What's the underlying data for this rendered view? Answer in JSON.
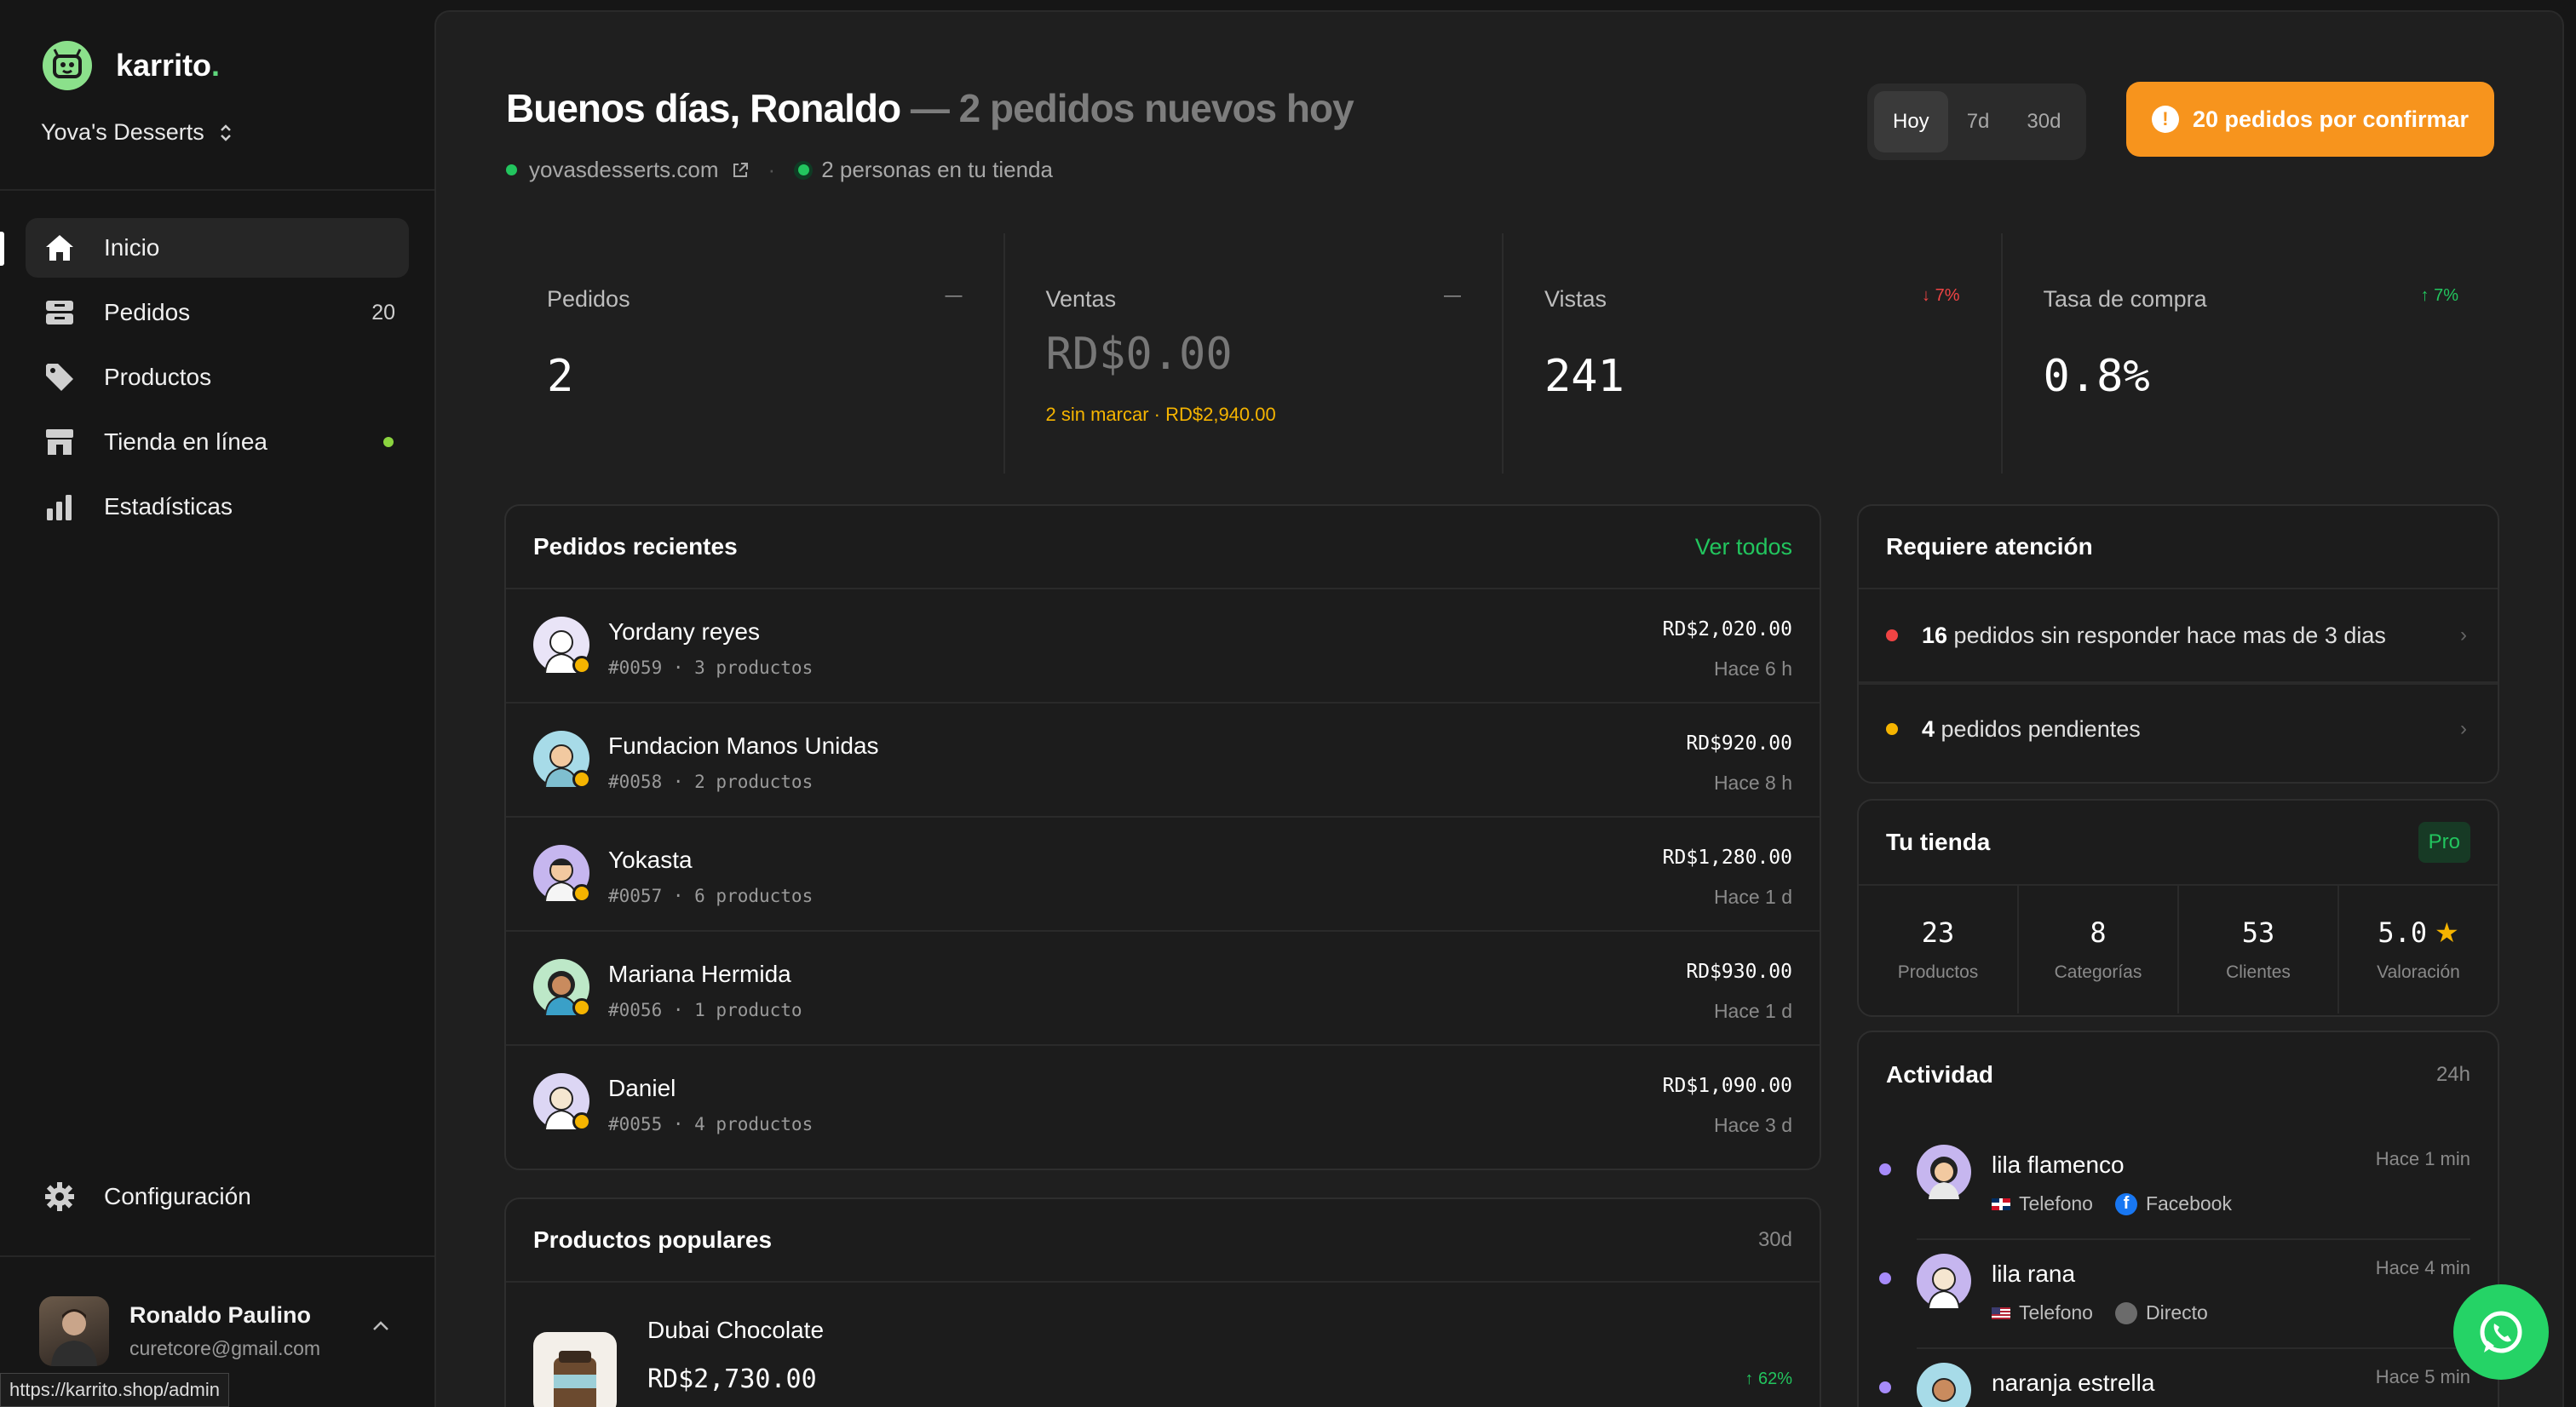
{
  "brand": {
    "name": "karrito",
    "dot": "."
  },
  "store": {
    "name": "Yova's Desserts"
  },
  "nav": {
    "items": [
      {
        "label": "Inicio",
        "icon": "home-icon"
      },
      {
        "label": "Pedidos",
        "icon": "inbox-icon",
        "count": "20"
      },
      {
        "label": "Productos",
        "icon": "tag-icon"
      },
      {
        "label": "Tienda en línea",
        "icon": "storefront-icon",
        "status": "online"
      },
      {
        "label": "Estadísticas",
        "icon": "bar-chart-icon"
      }
    ],
    "settings": "Configuración"
  },
  "user": {
    "name": "Ronaldo Paulino",
    "email": "curetcore@gmail.com"
  },
  "url_tooltip": "https://karrito.shop/admin",
  "header": {
    "greeting": "Buenos días, Ronaldo",
    "subtitle": " — 2 pedidos nuevos hoy",
    "site": "yovasdesserts.com",
    "visitors": "2 personas en tu tienda",
    "ranges": [
      "Hoy",
      "7d",
      "30d"
    ],
    "selected_range": "Hoy",
    "confirm_button": "20 pedidos por confirmar"
  },
  "stats": [
    {
      "label": "Pedidos",
      "trend": "—",
      "value": "2"
    },
    {
      "label": "Ventas",
      "trend": "—",
      "value": "RD$0.00",
      "note": "2 sin marcar · RD$2,940.00"
    },
    {
      "label": "Vistas",
      "trend": "↓ 7%",
      "trend_color": "#ef4444",
      "value": "241"
    },
    {
      "label": "Tasa de compra",
      "trend": "↑ 7%",
      "trend_color": "#22c55e",
      "value": "0.8%"
    }
  ],
  "recent_orders": {
    "title": "Pedidos recientes",
    "link": "Ver todos",
    "rows": [
      {
        "name": "Yordany reyes",
        "sub": "#0059 · 3 productos",
        "amount": "RD$2,020.00",
        "time": "Hace 6 h",
        "avatar_color": "#e9e4f7"
      },
      {
        "name": "Fundacion Manos Unidas",
        "sub": "#0058 · 2 productos",
        "amount": "RD$920.00",
        "time": "Hace 8 h",
        "avatar_color": "#a7dbe8"
      },
      {
        "name": "Yokasta",
        "sub": "#0057 · 6 productos",
        "amount": "RD$1,280.00",
        "time": "Hace 1 d",
        "avatar_color": "#c6b6ef"
      },
      {
        "name": "Mariana Hermida",
        "sub": "#0056 · 1 producto",
        "amount": "RD$930.00",
        "time": "Hace 1 d",
        "avatar_color": "#bde8c8"
      },
      {
        "name": "Daniel",
        "sub": "#0055 · 4 productos",
        "amount": "RD$1,090.00",
        "time": "Hace 3 d",
        "avatar_color": "#dcd6f4"
      }
    ]
  },
  "popular_products": {
    "title": "Productos populares",
    "range": "30d",
    "items": [
      {
        "name": "Dubai Chocolate",
        "price": "RD$2,730.00",
        "trend": "↑ 62%"
      }
    ]
  },
  "attention": {
    "title": "Requiere atención",
    "items": [
      {
        "count": "16",
        "text": " pedidos sin responder hace mas de 3 dias",
        "color": "#ef4444"
      },
      {
        "count": "4",
        "text": " pedidos pendientes",
        "color": "#f5b400"
      }
    ]
  },
  "store_card": {
    "title": "Tu tienda",
    "badge": "Pro",
    "stats": [
      {
        "value": "23",
        "label": "Productos"
      },
      {
        "value": "8",
        "label": "Categorías"
      },
      {
        "value": "53",
        "label": "Clientes"
      },
      {
        "value": "5.0",
        "label": "Valoración",
        "icon": "star-icon"
      }
    ]
  },
  "activity": {
    "title": "Actividad",
    "range": "24h",
    "items": [
      {
        "name": "lila flamenco",
        "phone": "Telefono",
        "source": "Facebook",
        "time": "Hace 1 min",
        "flag": "dominican-republic",
        "avatar_color": "#c6b6ef"
      },
      {
        "name": "lila rana",
        "phone": "Telefono",
        "source": "Directo",
        "time": "Hace 4 min",
        "flag": "united-states",
        "avatar_color": "#c6b6ef"
      },
      {
        "name": "naranja estrella",
        "phone": "",
        "source": "",
        "time": "Hace 5 min",
        "flag": "",
        "avatar_color": "#a7dbe8"
      }
    ]
  },
  "colors": {
    "accent": "#f7941d",
    "success": "#22c55e",
    "warning": "#f5b400",
    "danger": "#ef4444",
    "whatsapp": "#25d366"
  }
}
